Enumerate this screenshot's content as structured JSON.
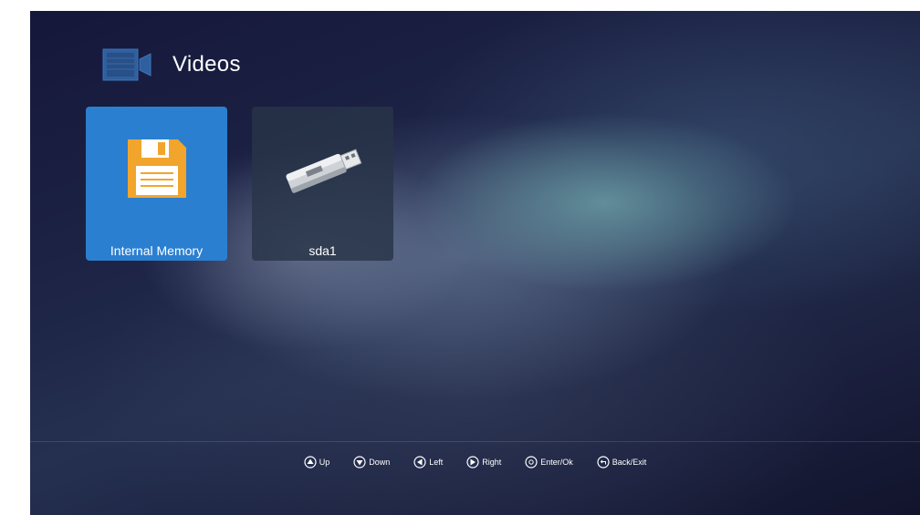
{
  "header": {
    "title": "Videos",
    "icon": "video-camera-icon"
  },
  "sources": [
    {
      "label": "Internal Memory",
      "icon": "floppy-disk-icon",
      "selected": true
    },
    {
      "label": "sda1",
      "icon": "usb-drive-icon",
      "selected": false
    }
  ],
  "footer": {
    "hints": [
      {
        "icon": "up-arrow-icon",
        "label": "Up"
      },
      {
        "icon": "down-arrow-icon",
        "label": "Down"
      },
      {
        "icon": "left-arrow-icon",
        "label": "Left"
      },
      {
        "icon": "right-arrow-icon",
        "label": "Right"
      },
      {
        "icon": "ok-icon",
        "label": "Enter/Ok"
      },
      {
        "icon": "back-icon",
        "label": "Back/Exit"
      }
    ]
  },
  "colors": {
    "selected_tile": "#2b7fd0",
    "floppy": "#f2a52c"
  }
}
